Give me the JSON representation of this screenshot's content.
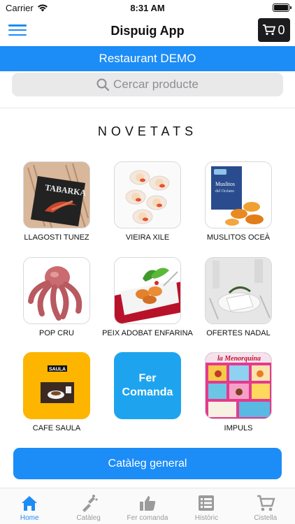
{
  "status_bar": {
    "carrier": "Carrier",
    "time": "8:31 AM"
  },
  "navbar": {
    "title": "Dispuig App",
    "cart_count": "0"
  },
  "restaurant": "Restaurant DEMO",
  "search": {
    "placeholder": "Cercar producte"
  },
  "section_title": "NOVETATS",
  "products": [
    {
      "name": "LLAGOSTI TUNEZ"
    },
    {
      "name": "VIEIRA XILE"
    },
    {
      "name": "MUSLITOS OCEÀ"
    },
    {
      "name": "POP CRU"
    },
    {
      "name": "PEIX ADOBAT ENFARINA"
    },
    {
      "name": "OFERTES NADAL"
    },
    {
      "name": "CAFE SAULA",
      "image_text": "SAULA"
    },
    {
      "name": "",
      "tile_text_line1": "Fer",
      "tile_text_line2": "Comanda"
    },
    {
      "name": "IMPULS",
      "image_text": "la Menorquina"
    }
  ],
  "catalog_button": "Catàleg general",
  "tabs": [
    {
      "label": "Home",
      "icon": "home-icon"
    },
    {
      "label": "Catàleg",
      "icon": "catalog-icon"
    },
    {
      "label": "Fer comanda",
      "icon": "thumbs-up-icon"
    },
    {
      "label": "Històric",
      "icon": "history-list-icon"
    },
    {
      "label": "Cistella",
      "icon": "cart-icon"
    }
  ],
  "colors": {
    "accent": "#1c8cf7",
    "tab_active": "#1d8cf5",
    "tab_inactive": "#9b9b9b",
    "cart_button": "#1c1c1e",
    "cafe_tile": "#fdb500"
  }
}
